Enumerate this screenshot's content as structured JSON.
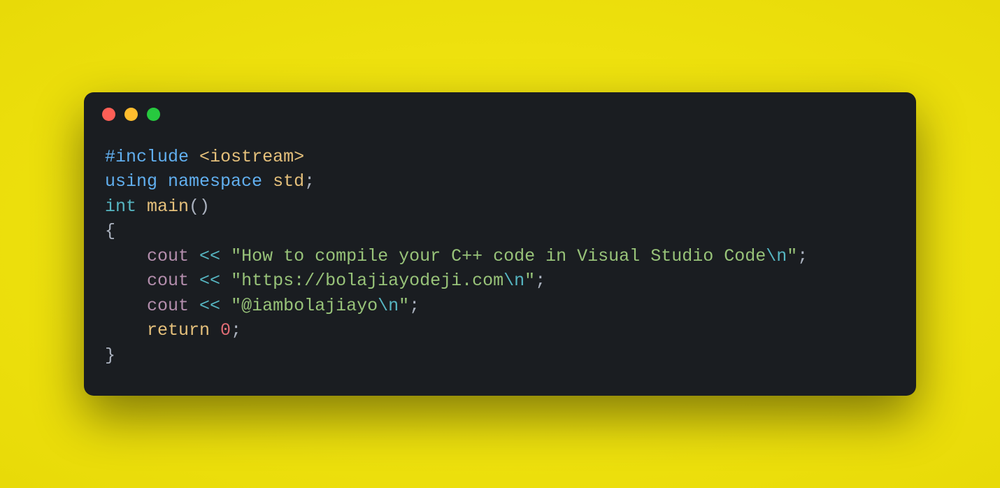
{
  "code": {
    "line1": {
      "include": "#include",
      "lt": "<",
      "header": "iostream",
      "gt": ">"
    },
    "line2": {
      "using": "using",
      "namespace": "namespace",
      "std": "std",
      "semi": ";"
    },
    "line3": {
      "int": "int",
      "main": "main",
      "parens": "()"
    },
    "line4": {
      "brace": "{"
    },
    "line5": {
      "cout": "cout",
      "op": "<<",
      "str_open": "\"",
      "str_body": "How to compile your C++ code in Visual Studio Code",
      "esc": "\\n",
      "str_close": "\"",
      "semi": ";"
    },
    "line6": {
      "cout": "cout",
      "op": "<<",
      "str_open": "\"",
      "str_body": "https://bolajiayodeji.com",
      "esc": "\\n",
      "str_close": "\"",
      "semi": ";"
    },
    "line7": {
      "cout": "cout",
      "op": "<<",
      "str_open": "\"",
      "str_body": "@iambolajiayo",
      "esc": "\\n",
      "str_close": "\"",
      "semi": ";"
    },
    "line8": {
      "return": "return",
      "zero": "0",
      "semi": ";"
    },
    "line9": {
      "brace": "}"
    }
  }
}
